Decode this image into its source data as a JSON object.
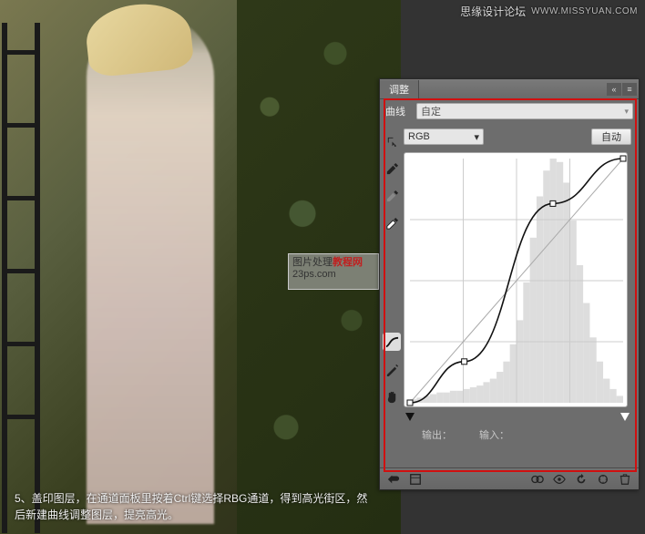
{
  "watermark": {
    "site_cn": "思缘设计论坛",
    "site_url": "WWW.MISSYUAN.COM"
  },
  "mid_watermark": {
    "line1_a": "图片处理",
    "line1_b": "教程网",
    "line2": "23ps.com"
  },
  "caption": {
    "text": "5、盖印图层，在通道面板里按着Ctrl键选择RBG通道，得到高光街区，然后新建曲线调整图层，提亮高光。"
  },
  "panel": {
    "tab": "调整",
    "preset_label": "曲线",
    "preset_value": "自定",
    "channel": "RGB",
    "auto": "自动",
    "output_label": "输出：",
    "input_label": "输入：",
    "tools": {
      "target": "target-adjust-tool",
      "eyedrop_black": "black-point-eyedropper",
      "eyedrop_gray": "gray-point-eyedropper",
      "eyedrop_white": "white-point-eyedropper",
      "pencil": "draw-curve-tool",
      "curve": "point-curve-tool",
      "hand": "hand-tool"
    },
    "footer": {
      "toggle": "layer-visibility-toggle",
      "prev": "view-previous-state",
      "reset": "reset-adjustment",
      "clip": "clip-to-layer",
      "trash": "delete-adjustment"
    }
  },
  "chart_data": {
    "type": "line",
    "title": "Curves adjustment — RGB",
    "xlabel": "Input",
    "ylabel": "Output",
    "xlim": [
      0,
      255
    ],
    "ylim": [
      0,
      255
    ],
    "grid": true,
    "series": [
      {
        "name": "baseline",
        "x": [
          0,
          255
        ],
        "y": [
          0,
          255
        ]
      },
      {
        "name": "curve",
        "x": [
          0,
          65,
          171,
          255
        ],
        "y": [
          0,
          43,
          208,
          255
        ]
      }
    ],
    "control_points": [
      {
        "x": 0,
        "y": 0
      },
      {
        "x": 65,
        "y": 43
      },
      {
        "x": 171,
        "y": 208
      },
      {
        "x": 255,
        "y": 255
      }
    ],
    "histogram": {
      "bins": 32,
      "values": [
        2,
        3,
        4,
        5,
        6,
        6,
        7,
        7,
        8,
        9,
        10,
        12,
        14,
        18,
        24,
        34,
        48,
        70,
        96,
        120,
        135,
        142,
        140,
        128,
        106,
        80,
        58,
        38,
        24,
        14,
        8,
        4
      ]
    }
  }
}
